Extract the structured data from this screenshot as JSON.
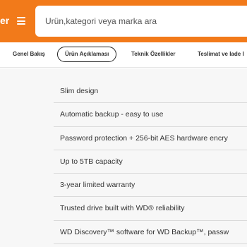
{
  "header": {
    "logo_fragment": "er",
    "search": {
      "placeholder": "Urün,kategori veya marka ara",
      "value": ""
    },
    "accent_color": "#f27a1a",
    "menu_icon": "hamburger-menu-icon"
  },
  "tabs": [
    {
      "label": "Genel Bakış",
      "active": false
    },
    {
      "label": "Ürün Açıklaması",
      "active": true
    },
    {
      "label": "Teknik Özellikler",
      "active": false
    },
    {
      "label": "Teslimat ve Iade I",
      "active": false
    }
  ],
  "features": [
    "Slim design",
    "Automatic backup - easy to use",
    "Password protection + 256-bit AES hardware encry",
    "Up to 5TB capacity",
    "3-year limited warranty",
    "Trusted drive built with WD® reliability",
    "WD Discovery™ software for WD Backup™, passw"
  ]
}
